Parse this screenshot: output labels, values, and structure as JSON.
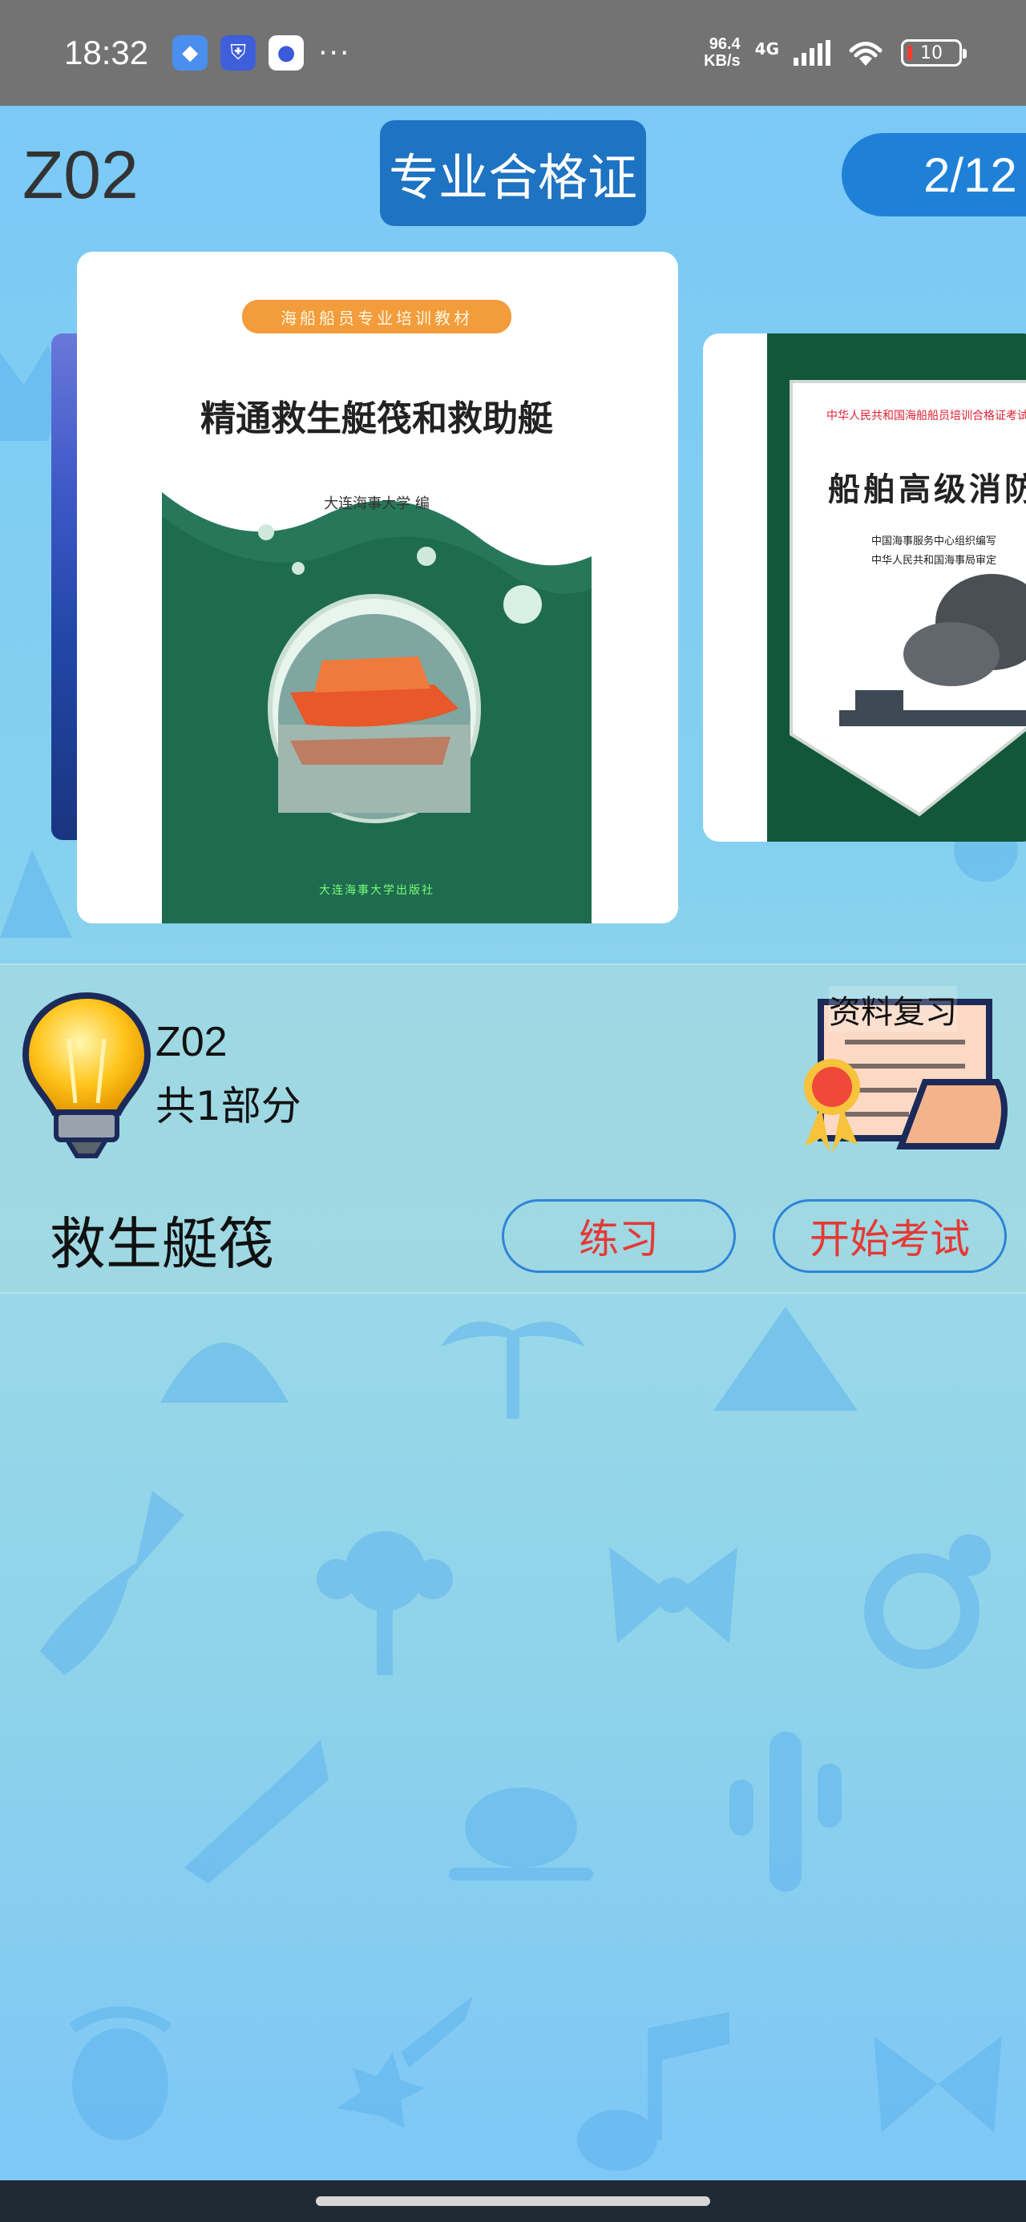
{
  "status_bar": {
    "time": "18:32",
    "app_icons": [
      "diamond-app-icon",
      "shield-app-icon",
      "circle-app-icon"
    ],
    "more": "···",
    "net_speed_value": "96.4",
    "net_speed_unit": "KB/s",
    "net_type": "4G",
    "battery": "10"
  },
  "header": {
    "code": "Z02",
    "category_button": "专业合格证",
    "page_indicator": "2/12"
  },
  "carousel": {
    "current_book": {
      "banner": "海船船员专业培训教材",
      "title": "精通救生艇筏和救助艇",
      "author": "大连海事大学  编",
      "publisher": "大连海事大学出版社"
    },
    "next_book": {
      "banner": "中华人民共和国海船船员培训合格证考试培训教材",
      "title": "船舶高级消防",
      "subtitle_1": "中国海事服务中心组织编写",
      "subtitle_2": "中华人民共和国海事局审定"
    }
  },
  "info": {
    "code": "Z02",
    "parts_count": "共1部分",
    "review_label": "资料复习",
    "part_name": "救生艇筏",
    "practice_button": "练习",
    "exam_button": "开始考试"
  },
  "colors": {
    "status_bar": "#737373",
    "primary_blue": "#1e73c2",
    "button_text_red": "#e53935",
    "button_border": "#2d84d8",
    "background": "#86d1ef"
  }
}
